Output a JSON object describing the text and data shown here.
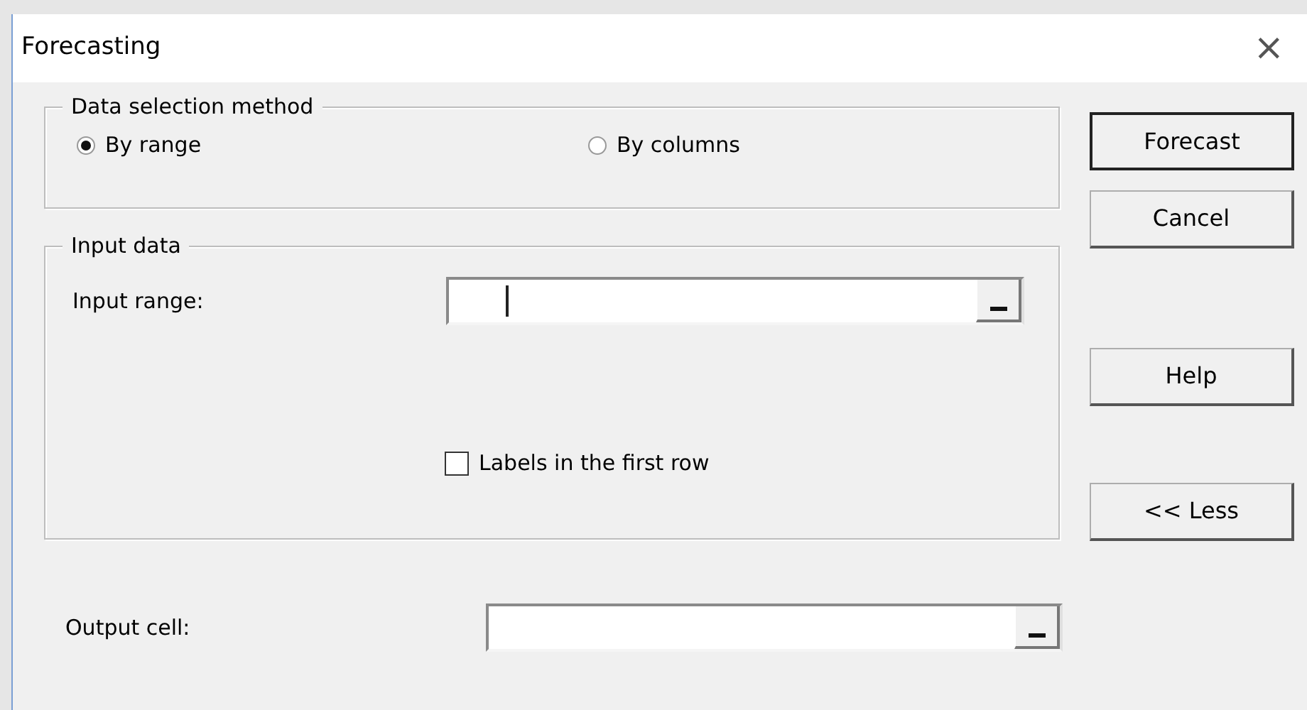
{
  "window": {
    "title": "Forecasting",
    "close": "×"
  },
  "data_selection": {
    "legend": "Data selection method",
    "options": [
      {
        "label": "By range",
        "selected": true
      },
      {
        "label": "By columns",
        "selected": false
      }
    ]
  },
  "input_data": {
    "legend": "Input data",
    "input_range": {
      "label": "Input range:",
      "focused": true
    },
    "labels_checkbox": {
      "label": "Labels in the first row",
      "checked": false
    }
  },
  "output_cell": {
    "label": "Output cell:",
    "focused": false
  },
  "buttons": [
    {
      "label": "Forecast",
      "default": true
    },
    {
      "label": "Cancel",
      "default": false
    },
    {
      "label": "Help",
      "default": false
    },
    {
      "label": "<< Less",
      "default": false
    }
  ]
}
